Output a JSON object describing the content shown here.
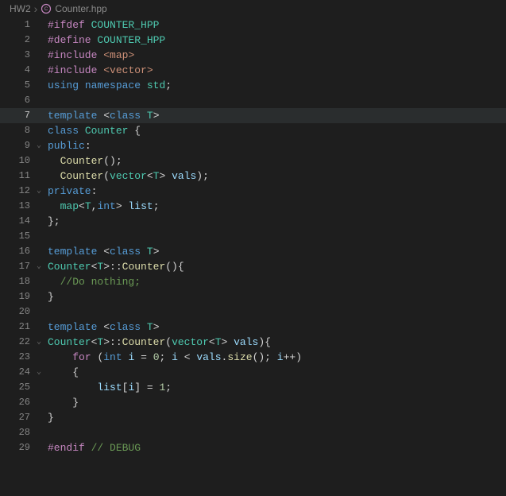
{
  "breadcrumb": {
    "folder": "HW2",
    "file": "Counter.hpp"
  },
  "current_line": 7,
  "lines": [
    {
      "n": 1,
      "fold": "",
      "tokens": [
        {
          "c": "ctrl",
          "t": "#ifdef"
        },
        {
          "c": "op",
          "t": " "
        },
        {
          "c": "mac",
          "t": "COUNTER_HPP"
        }
      ]
    },
    {
      "n": 2,
      "fold": "",
      "tokens": [
        {
          "c": "ctrl",
          "t": "#define"
        },
        {
          "c": "op",
          "t": " "
        },
        {
          "c": "mac",
          "t": "COUNTER_HPP"
        }
      ]
    },
    {
      "n": 3,
      "fold": "",
      "tokens": [
        {
          "c": "ctrl",
          "t": "#include"
        },
        {
          "c": "op",
          "t": " "
        },
        {
          "c": "str",
          "t": "<map>"
        }
      ]
    },
    {
      "n": 4,
      "fold": "",
      "tokens": [
        {
          "c": "ctrl",
          "t": "#include"
        },
        {
          "c": "op",
          "t": " "
        },
        {
          "c": "str",
          "t": "<vector>"
        }
      ]
    },
    {
      "n": 5,
      "fold": "",
      "tokens": [
        {
          "c": "kw",
          "t": "using"
        },
        {
          "c": "op",
          "t": " "
        },
        {
          "c": "kw",
          "t": "namespace"
        },
        {
          "c": "op",
          "t": " "
        },
        {
          "c": "type",
          "t": "std"
        },
        {
          "c": "punc",
          "t": ";"
        }
      ]
    },
    {
      "n": 6,
      "fold": "",
      "tokens": []
    },
    {
      "n": 7,
      "fold": "",
      "tokens": [
        {
          "c": "kw",
          "t": "template"
        },
        {
          "c": "op",
          "t": " "
        },
        {
          "c": "punc",
          "t": "<"
        },
        {
          "c": "kw",
          "t": "class"
        },
        {
          "c": "op",
          "t": " "
        },
        {
          "c": "type",
          "t": "T"
        },
        {
          "c": "punc",
          "t": ">"
        }
      ]
    },
    {
      "n": 8,
      "fold": "",
      "tokens": [
        {
          "c": "kw",
          "t": "class"
        },
        {
          "c": "op",
          "t": " "
        },
        {
          "c": "type",
          "t": "Counter"
        },
        {
          "c": "op",
          "t": " "
        },
        {
          "c": "punc",
          "t": "{"
        }
      ]
    },
    {
      "n": 9,
      "fold": "v",
      "tokens": [
        {
          "c": "kw",
          "t": "public"
        },
        {
          "c": "punc",
          "t": ":"
        }
      ],
      "dedent": true
    },
    {
      "n": 10,
      "fold": "",
      "tokens": [
        {
          "c": "op",
          "t": "  "
        },
        {
          "c": "fn",
          "t": "Counter"
        },
        {
          "c": "punc",
          "t": "();"
        }
      ]
    },
    {
      "n": 11,
      "fold": "",
      "tokens": [
        {
          "c": "op",
          "t": "  "
        },
        {
          "c": "fn",
          "t": "Counter"
        },
        {
          "c": "punc",
          "t": "("
        },
        {
          "c": "type",
          "t": "vector"
        },
        {
          "c": "punc",
          "t": "<"
        },
        {
          "c": "type",
          "t": "T"
        },
        {
          "c": "punc",
          "t": "> "
        },
        {
          "c": "var",
          "t": "vals"
        },
        {
          "c": "punc",
          "t": ");"
        }
      ]
    },
    {
      "n": 12,
      "fold": "v",
      "tokens": [
        {
          "c": "kw",
          "t": "private"
        },
        {
          "c": "punc",
          "t": ":"
        }
      ],
      "dedent": true
    },
    {
      "n": 13,
      "fold": "",
      "tokens": [
        {
          "c": "op",
          "t": "  "
        },
        {
          "c": "type",
          "t": "map"
        },
        {
          "c": "punc",
          "t": "<"
        },
        {
          "c": "type",
          "t": "T"
        },
        {
          "c": "punc",
          "t": ","
        },
        {
          "c": "kw",
          "t": "int"
        },
        {
          "c": "punc",
          "t": "> "
        },
        {
          "c": "var",
          "t": "list"
        },
        {
          "c": "punc",
          "t": ";"
        }
      ]
    },
    {
      "n": 14,
      "fold": "",
      "tokens": [
        {
          "c": "punc",
          "t": "};"
        }
      ]
    },
    {
      "n": 15,
      "fold": "",
      "tokens": []
    },
    {
      "n": 16,
      "fold": "",
      "tokens": [
        {
          "c": "kw",
          "t": "template"
        },
        {
          "c": "op",
          "t": " "
        },
        {
          "c": "punc",
          "t": "<"
        },
        {
          "c": "kw",
          "t": "class"
        },
        {
          "c": "op",
          "t": " "
        },
        {
          "c": "type",
          "t": "T"
        },
        {
          "c": "punc",
          "t": ">"
        }
      ]
    },
    {
      "n": 17,
      "fold": "v",
      "tokens": [
        {
          "c": "type",
          "t": "Counter"
        },
        {
          "c": "punc",
          "t": "<"
        },
        {
          "c": "type",
          "t": "T"
        },
        {
          "c": "punc",
          "t": ">::"
        },
        {
          "c": "fn",
          "t": "Counter"
        },
        {
          "c": "punc",
          "t": "(){"
        }
      ],
      "dedent": true
    },
    {
      "n": 18,
      "fold": "",
      "tokens": [
        {
          "c": "op",
          "t": "  "
        },
        {
          "c": "cmt",
          "t": "//Do nothing;"
        }
      ]
    },
    {
      "n": 19,
      "fold": "",
      "tokens": [
        {
          "c": "punc",
          "t": "}"
        }
      ]
    },
    {
      "n": 20,
      "fold": "",
      "tokens": []
    },
    {
      "n": 21,
      "fold": "",
      "tokens": [
        {
          "c": "kw",
          "t": "template"
        },
        {
          "c": "op",
          "t": " "
        },
        {
          "c": "punc",
          "t": "<"
        },
        {
          "c": "kw",
          "t": "class"
        },
        {
          "c": "op",
          "t": " "
        },
        {
          "c": "type",
          "t": "T"
        },
        {
          "c": "punc",
          "t": ">"
        }
      ]
    },
    {
      "n": 22,
      "fold": "v",
      "tokens": [
        {
          "c": "type",
          "t": "Counter"
        },
        {
          "c": "punc",
          "t": "<"
        },
        {
          "c": "type",
          "t": "T"
        },
        {
          "c": "punc",
          "t": ">::"
        },
        {
          "c": "fn",
          "t": "Counter"
        },
        {
          "c": "punc",
          "t": "("
        },
        {
          "c": "type",
          "t": "vector"
        },
        {
          "c": "punc",
          "t": "<"
        },
        {
          "c": "type",
          "t": "T"
        },
        {
          "c": "punc",
          "t": "> "
        },
        {
          "c": "var",
          "t": "vals"
        },
        {
          "c": "punc",
          "t": "){"
        }
      ],
      "dedent": true
    },
    {
      "n": 23,
      "fold": "",
      "tokens": [
        {
          "c": "op",
          "t": "    "
        },
        {
          "c": "ctrl",
          "t": "for"
        },
        {
          "c": "op",
          "t": " "
        },
        {
          "c": "punc",
          "t": "("
        },
        {
          "c": "kw",
          "t": "int"
        },
        {
          "c": "op",
          "t": " "
        },
        {
          "c": "var",
          "t": "i"
        },
        {
          "c": "op",
          "t": " = "
        },
        {
          "c": "num",
          "t": "0"
        },
        {
          "c": "punc",
          "t": "; "
        },
        {
          "c": "var",
          "t": "i"
        },
        {
          "c": "op",
          "t": " < "
        },
        {
          "c": "var",
          "t": "vals"
        },
        {
          "c": "punc",
          "t": "."
        },
        {
          "c": "fn",
          "t": "size"
        },
        {
          "c": "punc",
          "t": "(); "
        },
        {
          "c": "var",
          "t": "i"
        },
        {
          "c": "op",
          "t": "++"
        },
        {
          "c": "punc",
          "t": ")"
        }
      ]
    },
    {
      "n": 24,
      "fold": "v",
      "tokens": [
        {
          "c": "op",
          "t": "    "
        },
        {
          "c": "punc",
          "t": "{"
        }
      ]
    },
    {
      "n": 25,
      "fold": "",
      "tokens": [
        {
          "c": "op",
          "t": "        "
        },
        {
          "c": "var",
          "t": "list"
        },
        {
          "c": "punc",
          "t": "["
        },
        {
          "c": "var",
          "t": "i"
        },
        {
          "c": "punc",
          "t": "]"
        },
        {
          "c": "op",
          "t": " = "
        },
        {
          "c": "num",
          "t": "1"
        },
        {
          "c": "punc",
          "t": ";"
        }
      ]
    },
    {
      "n": 26,
      "fold": "",
      "tokens": [
        {
          "c": "op",
          "t": "    "
        },
        {
          "c": "punc",
          "t": "}"
        }
      ]
    },
    {
      "n": 27,
      "fold": "",
      "tokens": [
        {
          "c": "punc",
          "t": "}"
        }
      ]
    },
    {
      "n": 28,
      "fold": "",
      "tokens": []
    },
    {
      "n": 29,
      "fold": "",
      "tokens": [
        {
          "c": "ctrl",
          "t": "#endif"
        },
        {
          "c": "op",
          "t": " "
        },
        {
          "c": "cmt",
          "t": "// DEBUG"
        }
      ]
    }
  ]
}
